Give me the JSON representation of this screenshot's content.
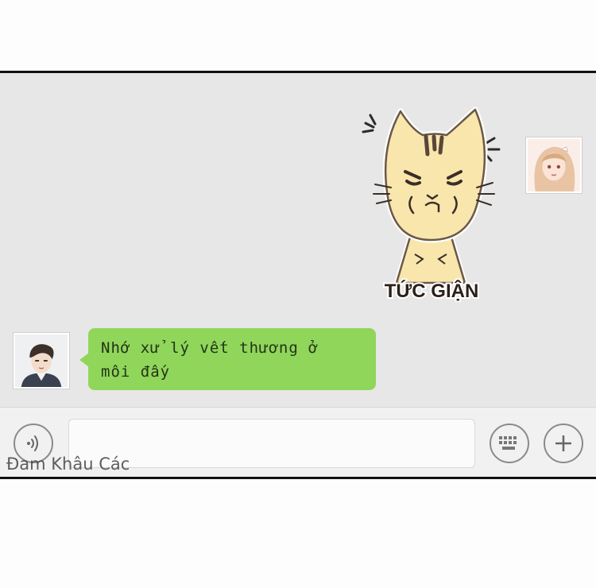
{
  "chat": {
    "sticker": {
      "caption": "TỨC GIẬN"
    },
    "messages": [
      {
        "sender": "other",
        "text_line1": "Nhớ xử lý vết thương ở",
        "text_line2": "môi đấy"
      }
    ]
  },
  "input_bar": {
    "voice_icon": "voice-wave-icon",
    "keyboard_icon": "keyboard-icon",
    "plus_icon": "plus-icon",
    "text_value": ""
  },
  "watermark": {
    "text": "Đam Khâu Các"
  },
  "colors": {
    "chat_background": "#e7e7e7",
    "bubble_green": "#8fd65a",
    "input_bar": "#f1f1f1",
    "sticker_cat": "#f8e6ad"
  }
}
